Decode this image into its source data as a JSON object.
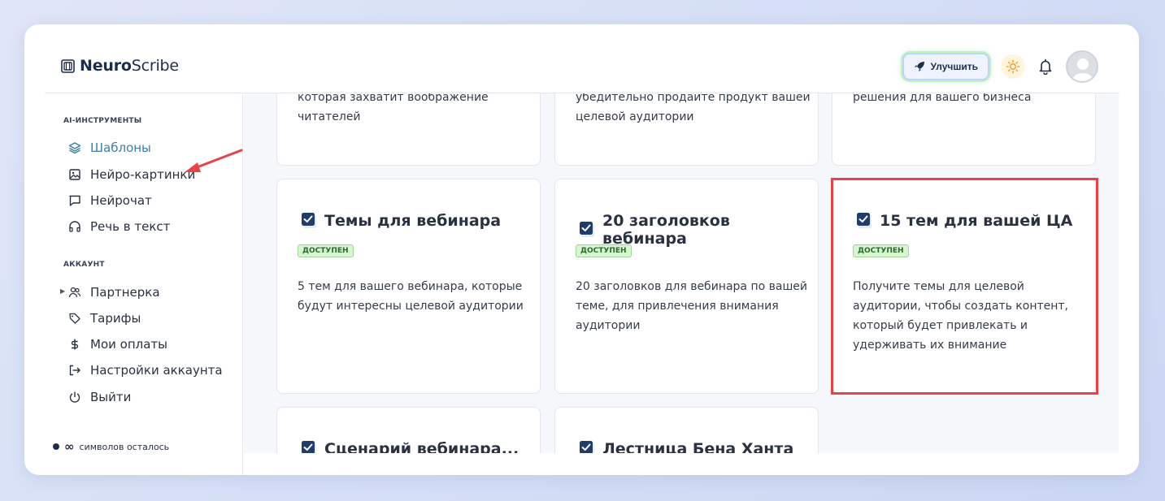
{
  "app": {
    "logo_bold": "Neuro",
    "logo_regular": "Scribe"
  },
  "header": {
    "upgrade_label": "Улучшить"
  },
  "sidebar": {
    "section_ai": "AI-ИНСТРУМЕНТЫ",
    "section_account": "АККАУНТ",
    "ai_items": [
      {
        "label": "Шаблоны",
        "icon": "layers-icon"
      },
      {
        "label": "Нейро-картинки",
        "icon": "image-icon"
      },
      {
        "label": "Нейрочат",
        "icon": "chat-icon"
      },
      {
        "label": "Речь в текст",
        "icon": "headphones-icon"
      }
    ],
    "account_items": [
      {
        "label": "Партнерка",
        "icon": "users-icon"
      },
      {
        "label": "Тарифы",
        "icon": "tag-icon"
      },
      {
        "label": "Мои оплаты",
        "icon": "dollar-icon"
      },
      {
        "label": "Настройки аккаунта",
        "icon": "logout-arrow-icon"
      },
      {
        "label": "Выйти",
        "icon": "power-icon"
      }
    ],
    "symbols_infinity": "∞",
    "symbols_label": "символов осталось"
  },
  "cards_top": [
    {
      "desc": "которая захватит воображение читателей"
    },
    {
      "desc": "убедительно продайте продукт вашей целевой аудитории"
    },
    {
      "desc": "решения для вашего бизнеса"
    }
  ],
  "cards": [
    {
      "title": "Темы для вебинара",
      "badge": "ДОСТУПЕН",
      "desc": "5 тем для вашего вебинара, которые будут интересны целевой аудитории"
    },
    {
      "title": "20 заголовков вебинара",
      "badge": "ДОСТУПЕН",
      "desc": "20 заголовков для вебинара по вашей теме, для привлечения внимания аудитории"
    },
    {
      "title": "15 тем для вашей ЦА",
      "badge": "ДОСТУПЕН",
      "desc": "Получите темы для целевой аудитории, чтобы создать контент, который будет привлекать и удерживать их внимание"
    }
  ],
  "cards_bottom": [
    {
      "title": "Сценарий вебинара..."
    },
    {
      "title": "Лестница Бена Ханта"
    }
  ],
  "colors": {
    "accent": "#3d7fa8",
    "highlight": "#e8434b",
    "badge_bg": "#d8f5d2",
    "navy": "#1f2d4d"
  }
}
